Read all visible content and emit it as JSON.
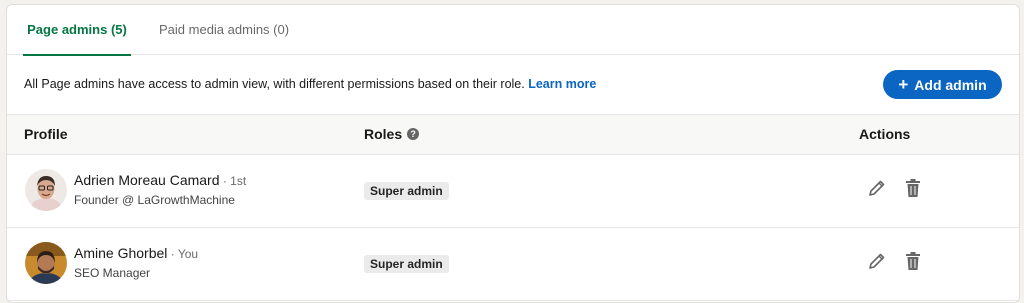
{
  "tabs": [
    {
      "label": "Page admins (5)",
      "active": true
    },
    {
      "label": "Paid media admins (0)",
      "active": false
    }
  ],
  "info": {
    "text": "All Page admins have access to admin view, with different permissions based on their role. ",
    "learn_more": "Learn more"
  },
  "add_button": {
    "icon": "plus-icon",
    "label": "Add admin"
  },
  "table": {
    "headers": {
      "profile": "Profile",
      "roles": "Roles",
      "roles_help_icon": "?",
      "actions": "Actions"
    },
    "rows": [
      {
        "name": "Adrien Moreau Camard",
        "degree": " · 1st",
        "subtitle": "Founder @ LaGrowthMachine",
        "role": "Super admin"
      },
      {
        "name": "Amine Ghorbel",
        "degree": " · You",
        "subtitle": "SEO Manager",
        "role": "Super admin"
      }
    ]
  },
  "colors": {
    "accent_green": "#057642",
    "primary_blue": "#0a66c2"
  }
}
